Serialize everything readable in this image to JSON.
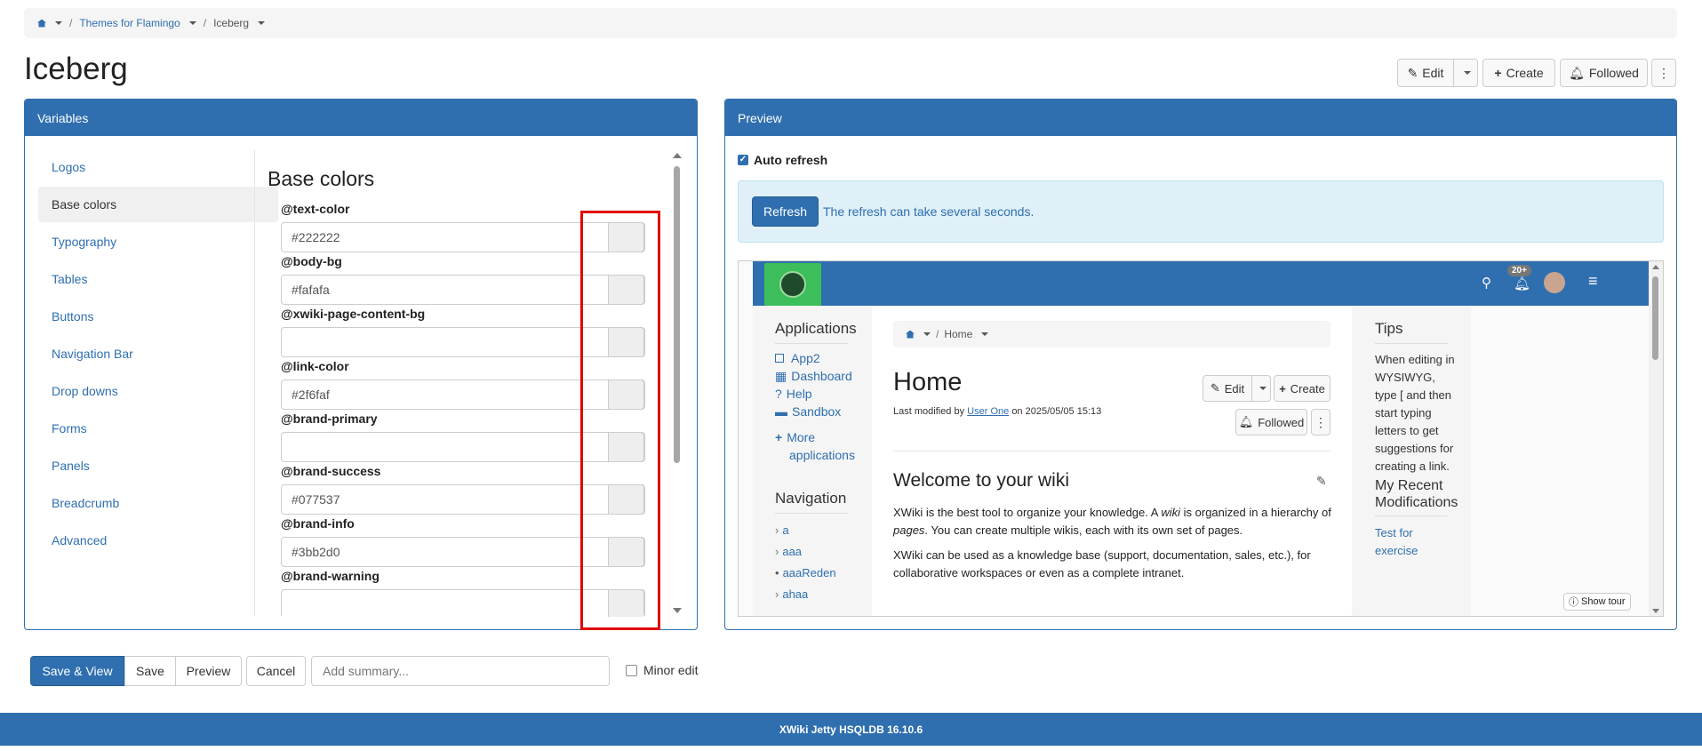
{
  "breadcrumb": {
    "items": [
      "Themes for Flamingo",
      "Iceberg"
    ]
  },
  "page": {
    "title": "Iceberg"
  },
  "actions": {
    "edit": "Edit",
    "create": "Create",
    "followed": "Followed"
  },
  "variables_panel": {
    "heading": "Variables",
    "nav": [
      "Logos",
      "Base colors",
      "Typography",
      "Tables",
      "Buttons",
      "Navigation Bar",
      "Drop downs",
      "Forms",
      "Panels",
      "Breadcrumb",
      "Advanced"
    ],
    "active_index": 1,
    "section_title": "Base colors",
    "fields": [
      {
        "label": "@text-color",
        "value": "#222222"
      },
      {
        "label": "@body-bg",
        "value": "#fafafa"
      },
      {
        "label": "@xwiki-page-content-bg",
        "value": ""
      },
      {
        "label": "@link-color",
        "value": "#2f6faf"
      },
      {
        "label": "@brand-primary",
        "value": ""
      },
      {
        "label": "@brand-success",
        "value": "#077537"
      },
      {
        "label": "@brand-info",
        "value": "#3bb2d0"
      },
      {
        "label": "@brand-warning",
        "value": ""
      }
    ]
  },
  "preview_panel": {
    "heading": "Preview",
    "auto_refresh_label": "Auto refresh",
    "refresh_button": "Refresh",
    "refresh_note": "The refresh can take several seconds.",
    "notification_count": "20+",
    "applications": {
      "title": "Applications",
      "items": [
        "App2",
        "Dashboard",
        "Help",
        "Sandbox"
      ],
      "more_1": "More",
      "more_2": "applications"
    },
    "navigation": {
      "title": "Navigation",
      "items": [
        "a",
        "aaa",
        "aaaReden",
        "ahaa"
      ]
    },
    "content": {
      "breadcrumb": "Home",
      "title": "Home",
      "edit": "Edit",
      "create": "Create",
      "followed": "Followed",
      "modified_prefix": "Last modified by",
      "modified_user": "User One",
      "modified_suffix": "on 2025/05/05 15:13",
      "welcome": "Welcome to your wiki",
      "p1a": "XWiki is the best tool to organize your knowledge. A",
      "p1b": "wiki",
      "p1c": "is organized in a hierarchy of",
      "p1d": "pages",
      "p1e": ".",
      "p1f": "You can create multiple wikis, each with its own set of pages.",
      "p2": "XWiki can be used as a knowledge base (support, documentation, sales, etc.), for collaborative workspaces or even as a complete intranet."
    },
    "tips": {
      "title": "Tips",
      "lines": [
        "When editing in",
        "WYSIWYG,",
        "type [ and then",
        "start typing",
        "letters to get",
        "suggestions for",
        "creating a link."
      ]
    },
    "recent": {
      "title_1": "My Recent",
      "title_2": "Modifications",
      "link_1": "Test for",
      "link_2": "exercise"
    },
    "show_tour": "Show tour"
  },
  "bottom_bar": {
    "save_view": "Save & View",
    "save": "Save",
    "preview": "Preview",
    "cancel": "Cancel",
    "summary_placeholder": "Add summary...",
    "minor_edit": "Minor edit"
  },
  "footer": {
    "text": "XWiki Jetty HSQLDB 16.10.6"
  },
  "colors": {
    "brand": "#2f6faf",
    "highlight_border": "#e00000",
    "info_bg": "#dff0f8"
  }
}
